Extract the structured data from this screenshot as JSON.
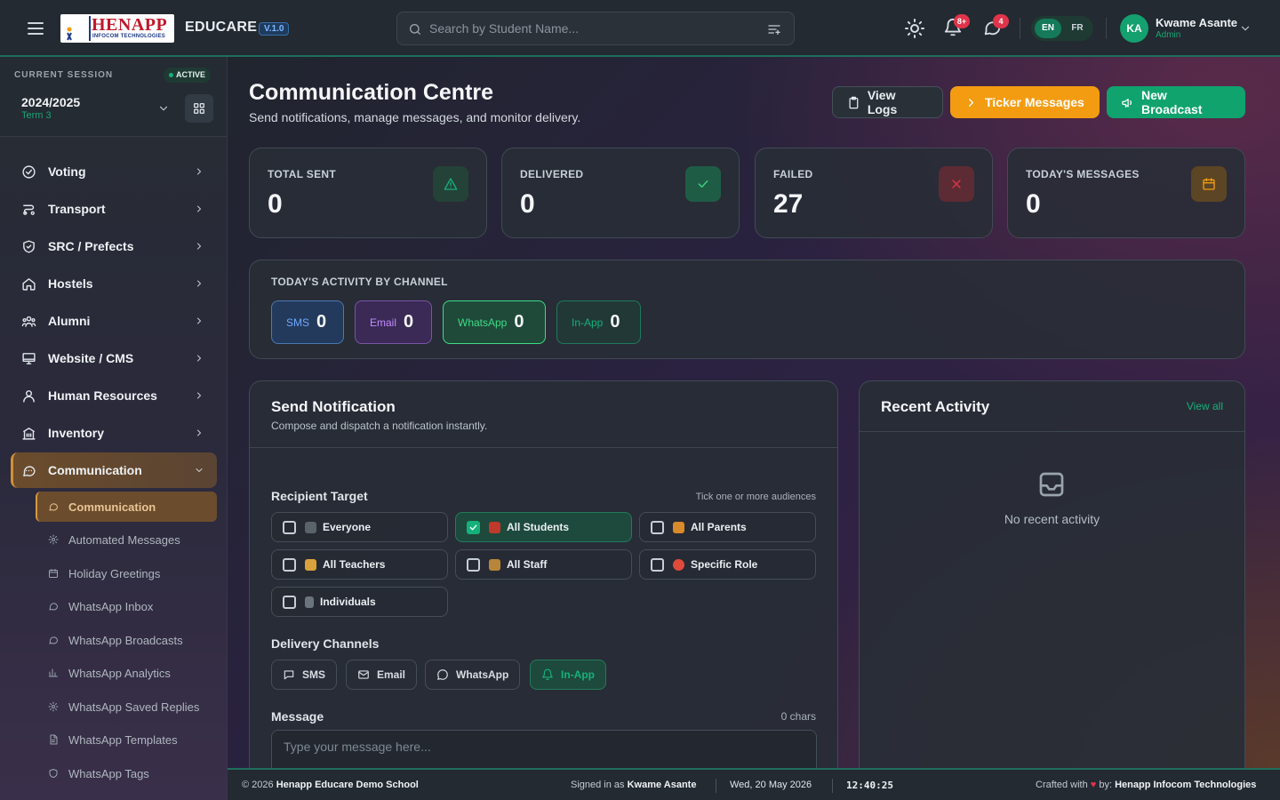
{
  "topbar": {
    "logo_text": "HENAPP",
    "logo_subtext": "INFOCOM TECHNOLOGIES",
    "brand": "EDUCARE",
    "version": "V.1.0",
    "search_placeholder": "Search by Student Name...",
    "notifications_badge": "8+",
    "messages_badge": "4",
    "languages": [
      "EN",
      "FR"
    ],
    "active_language": "EN",
    "user": {
      "initials": "KA",
      "name": "Kwame Asante",
      "role": "Admin"
    }
  },
  "sidebar": {
    "session_label": "CURRENT SESSION",
    "session_status": "ACTIVE",
    "session_year": "2024/2025",
    "session_term": "Term 3",
    "items": [
      {
        "label": "Voting",
        "icon": "check-circle-icon"
      },
      {
        "label": "Transport",
        "icon": "route-icon"
      },
      {
        "label": "SRC / Prefects",
        "icon": "shield-icon"
      },
      {
        "label": "Hostels",
        "icon": "home-icon"
      },
      {
        "label": "Alumni",
        "icon": "users-icon"
      },
      {
        "label": "Website / CMS",
        "icon": "monitor-icon"
      },
      {
        "label": "Human Resources",
        "icon": "user-icon"
      },
      {
        "label": "Inventory",
        "icon": "building-icon"
      },
      {
        "label": "Communication",
        "icon": "chat-icon"
      }
    ],
    "subitems": [
      {
        "label": "Communication",
        "icon": "chat-icon"
      },
      {
        "label": "Automated Messages",
        "icon": "gear-icon"
      },
      {
        "label": "Holiday Greetings",
        "icon": "calendar-icon"
      },
      {
        "label": "WhatsApp Inbox",
        "icon": "chat-icon"
      },
      {
        "label": "WhatsApp Broadcasts",
        "icon": "chat-icon"
      },
      {
        "label": "WhatsApp Analytics",
        "icon": "bar-chart-icon"
      },
      {
        "label": "WhatsApp Saved Replies",
        "icon": "gear-icon"
      },
      {
        "label": "WhatsApp Templates",
        "icon": "file-icon"
      },
      {
        "label": "WhatsApp Tags",
        "icon": "shield-icon"
      }
    ]
  },
  "header": {
    "title": "Communication Centre",
    "subtitle": "Send notifications, manage messages, and monitor delivery.",
    "view_logs": "View Logs",
    "ticker_messages": "Ticker Messages",
    "new_broadcast": "New Broadcast"
  },
  "stats": [
    {
      "label": "TOTAL SENT",
      "value": "0",
      "icon": "alert-triangle-icon",
      "color": "#16b07a"
    },
    {
      "label": "DELIVERED",
      "value": "0",
      "icon": "check-icon",
      "color": "#16b07a"
    },
    {
      "label": "FAILED",
      "value": "27",
      "icon": "x-icon",
      "color": "#e0344a"
    },
    {
      "label": "TODAY'S MESSAGES",
      "value": "0",
      "icon": "calendar-icon",
      "color": "#f39c12"
    }
  ],
  "channels": {
    "title": "TODAY'S ACTIVITY BY CHANNEL",
    "items": [
      {
        "label": "SMS",
        "value": "0",
        "color": "#6ea8ff"
      },
      {
        "label": "Email",
        "value": "0",
        "color": "#c58cff"
      },
      {
        "label": "WhatsApp",
        "value": "0",
        "color": "#3ddc84"
      },
      {
        "label": "In-App",
        "value": "0",
        "color": "#16b07a"
      }
    ]
  },
  "send_notification": {
    "title": "Send Notification",
    "subtitle": "Compose and dispatch a notification instantly.",
    "recipient_label": "Recipient Target",
    "recipient_hint": "Tick one or more audiences",
    "audiences": [
      {
        "label": "Everyone",
        "checked": false
      },
      {
        "label": "All Students",
        "checked": true
      },
      {
        "label": "All Parents",
        "checked": false
      },
      {
        "label": "All Teachers",
        "checked": false
      },
      {
        "label": "All Staff",
        "checked": false
      },
      {
        "label": "Specific Role",
        "checked": false
      },
      {
        "label": "Individuals",
        "checked": false
      }
    ],
    "delivery_label": "Delivery Channels",
    "delivery_channels": [
      {
        "label": "SMS",
        "selected": false
      },
      {
        "label": "Email",
        "selected": false
      },
      {
        "label": "WhatsApp",
        "selected": false
      },
      {
        "label": "In-App",
        "selected": true
      }
    ],
    "message_label": "Message",
    "char_count": "0 chars",
    "message_placeholder": "Type your message here..."
  },
  "recent_activity": {
    "title": "Recent Activity",
    "view_all": "View all",
    "empty_text": "No recent activity"
  },
  "footer": {
    "copyright_prefix": "© 2026",
    "school": "Henapp Educare Demo School",
    "signed_in_prefix": "Signed in as",
    "signed_in_user": "Kwame Asante",
    "date": "Wed, 20 May 2026",
    "time": "12:40:25",
    "crafted_prefix": "Crafted with",
    "crafted_by": "by:",
    "company": "Henapp Infocom Technologies"
  }
}
